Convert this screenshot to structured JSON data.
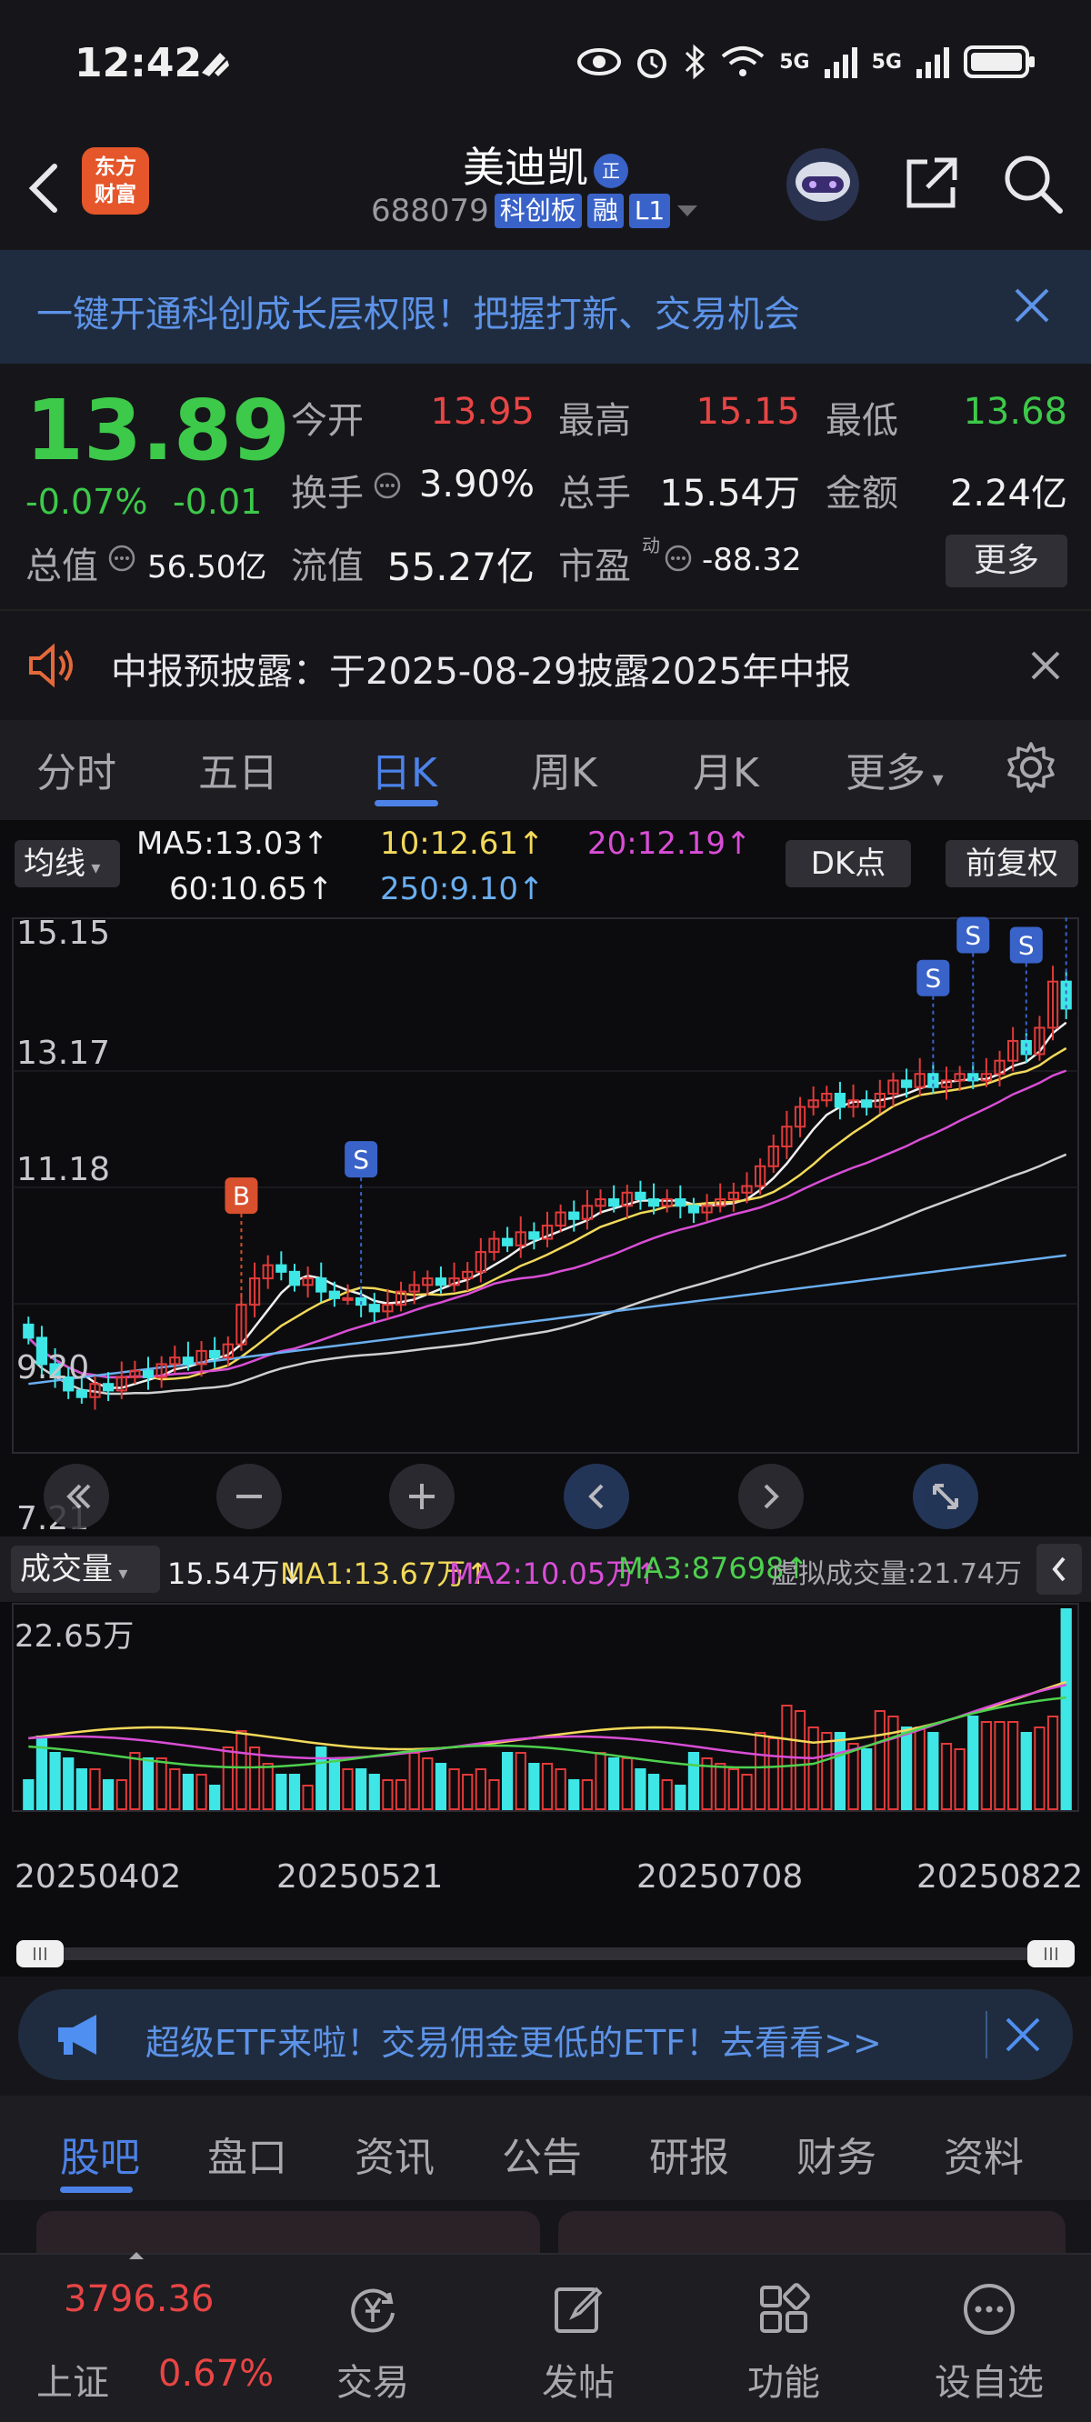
{
  "status_bar": {
    "time": "12:42",
    "signal1": "5G",
    "signal2": "5G"
  },
  "header": {
    "stock_name": "美迪凯",
    "verify_badge": "正",
    "code": "688079",
    "tags": [
      "科创板",
      "融",
      "L1"
    ]
  },
  "banner": {
    "text": "一键开通科创成长层权限！把握打新、交易机会"
  },
  "quote": {
    "price": "13.89",
    "change_pct": "-0.07%",
    "change": "-0.01",
    "fields": [
      {
        "label": "今开",
        "value": "13.95",
        "color": "red"
      },
      {
        "label": "最高",
        "value": "15.15",
        "color": "red"
      },
      {
        "label": "最低",
        "value": "13.68",
        "color": "green"
      },
      {
        "label": "换手",
        "value": "3.90%",
        "color": "white"
      },
      {
        "label": "总手",
        "value": "15.54万",
        "color": "white"
      },
      {
        "label": "金额",
        "value": "2.24亿",
        "color": "white"
      },
      {
        "label": "总值",
        "value": "56.50亿",
        "color": "white"
      },
      {
        "label": "流值",
        "value": "55.27亿",
        "color": "white"
      },
      {
        "label": "市盈",
        "value": "-88.32",
        "color": "white"
      }
    ],
    "pe_superscript": "动",
    "more_label": "更多"
  },
  "notice": {
    "text": "中报预披露：于2025-08-29披露2025年中报"
  },
  "period_tabs": [
    "分时",
    "五日",
    "日K",
    "周K",
    "月K",
    "更多"
  ],
  "active_period": "日K",
  "ma_legend": {
    "selector": "均线",
    "ma5": "MA5:13.03↑",
    "ma10": "10:12.61↑",
    "ma20": "20:12.19↑",
    "ma60": "60:10.65↑",
    "ma250": "250:9.10↑",
    "dk_button": "DK点",
    "adjust_button": "前复权"
  },
  "price_axis": [
    "15.15",
    "13.17",
    "11.18",
    "9.20",
    "7.21"
  ],
  "signal_markers": {
    "buy": "B",
    "sell": "S"
  },
  "volume_legend": {
    "selector": "成交量",
    "vol": "15.54万↓",
    "ma1": "MA1:13.67万↑",
    "ma2": "MA2:10.05万↑",
    "ma3": "MA3:87698↑",
    "virtual": "虚拟成交量:21.74万"
  },
  "volume_axis_max": "22.65万",
  "date_axis": [
    "20250402",
    "20250521",
    "20250708",
    "20250822"
  ],
  "chart_data": {
    "type": "candlestick",
    "price_range": [
      7.21,
      15.15
    ],
    "closes": [
      8.9,
      8.5,
      8.3,
      8.1,
      8.0,
      8.2,
      8.1,
      8.3,
      8.4,
      8.3,
      8.5,
      8.6,
      8.5,
      8.7,
      8.6,
      8.8,
      9.4,
      9.8,
      10.0,
      9.9,
      9.7,
      9.8,
      9.6,
      9.5,
      9.5,
      9.4,
      9.3,
      9.4,
      9.6,
      9.7,
      9.8,
      9.7,
      9.8,
      9.9,
      10.2,
      10.4,
      10.3,
      10.5,
      10.4,
      10.6,
      10.8,
      10.7,
      10.9,
      11.0,
      10.9,
      11.1,
      11.0,
      10.9,
      11.0,
      10.9,
      10.8,
      10.9,
      11.0,
      11.1,
      11.2,
      11.5,
      11.8,
      12.1,
      12.4,
      12.5,
      12.6,
      12.4,
      12.5,
      12.4,
      12.6,
      12.8,
      12.7,
      12.9,
      12.7,
      12.8,
      12.9,
      12.8,
      12.9,
      13.1,
      13.4,
      13.2,
      13.6,
      14.3,
      13.89
    ],
    "volume_max": "22.65万"
  },
  "chart_controls": [
    "zoom-out",
    "zoom-in",
    "scroll-left",
    "scroll-right",
    "fullscreen"
  ],
  "ad": {
    "text": "超级ETF来啦！交易佣金更低的ETF！去看看>>"
  },
  "sub_tabs": [
    "股吧",
    "盘口",
    "资讯",
    "公告",
    "研报",
    "财务",
    "资料"
  ],
  "active_sub_tab": "股吧",
  "bottom_nav": {
    "index_value": "3796.36",
    "index_name": "上证",
    "index_change": "0.67%",
    "items": [
      "交易",
      "发帖",
      "功能",
      "设自选"
    ]
  }
}
